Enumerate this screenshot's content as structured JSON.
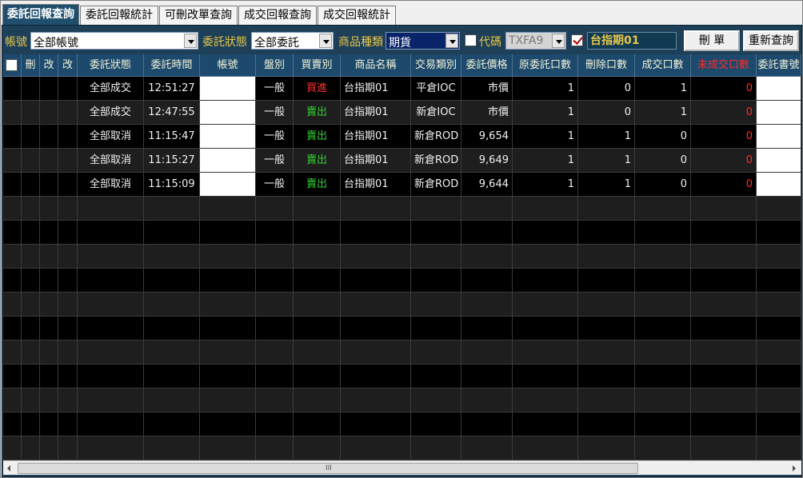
{
  "tabs": [
    {
      "label": "委託回報查詢",
      "active": true
    },
    {
      "label": "委託回報統計",
      "active": false
    },
    {
      "label": "可刪改單查詢",
      "active": false
    },
    {
      "label": "成交回報查詢",
      "active": false
    },
    {
      "label": "成交回報統計",
      "active": false
    }
  ],
  "toolbar": {
    "account_label": "帳號",
    "account_value": "全部帳號",
    "status_label": "委託狀態",
    "status_value": "全部委託",
    "product_type_label": "商品種類",
    "product_type_value": "期貨",
    "code_label": "代碼",
    "code_checked": false,
    "code_value": "TXFA9",
    "product_checked": true,
    "product_name": "台指期01",
    "delete_button": "刪 單",
    "requery_button": "重新查詢"
  },
  "table": {
    "headers": [
      "",
      "刪",
      "改",
      "改",
      "委託狀態",
      "委託時間",
      "帳號",
      "盤別",
      "買賣別",
      "商品名稱",
      "交易類別",
      "委託價格",
      "原委託口數",
      "刪除口數",
      "成交口數",
      "未成交口數",
      "委託書號"
    ],
    "rows": [
      {
        "status": "全部成交",
        "time": "12:51:27",
        "session": "一般",
        "side": "買進",
        "product": "台指期01",
        "trade_type": "平倉IOC",
        "price": "市價",
        "orig_qty": "1",
        "del_qty": "0",
        "filled_qty": "1",
        "unfilled_qty": "0"
      },
      {
        "status": "全部成交",
        "time": "12:47:55",
        "session": "一般",
        "side": "賣出",
        "product": "台指期01",
        "trade_type": "新倉IOC",
        "price": "市價",
        "orig_qty": "1",
        "del_qty": "0",
        "filled_qty": "1",
        "unfilled_qty": "0"
      },
      {
        "status": "全部取消",
        "time": "11:15:47",
        "session": "一般",
        "side": "賣出",
        "product": "台指期01",
        "trade_type": "新倉ROD",
        "price": "9,654",
        "orig_qty": "1",
        "del_qty": "1",
        "filled_qty": "0",
        "unfilled_qty": "0"
      },
      {
        "status": "全部取消",
        "time": "11:15:27",
        "session": "一般",
        "side": "賣出",
        "product": "台指期01",
        "trade_type": "新倉ROD",
        "price": "9,649",
        "orig_qty": "1",
        "del_qty": "1",
        "filled_qty": "0",
        "unfilled_qty": "0"
      },
      {
        "status": "全部取消",
        "time": "11:15:09",
        "session": "一般",
        "side": "賣出",
        "product": "台指期01",
        "trade_type": "新倉ROD",
        "price": "9,644",
        "orig_qty": "1",
        "del_qty": "1",
        "filled_qty": "0",
        "unfilled_qty": "0"
      }
    ]
  },
  "scrollbar": {
    "grip": "III"
  },
  "colors": {
    "panel": "#1d3f58",
    "header": "#1d4a6c",
    "label": "#e8c74a",
    "buy": "#ff3030",
    "sell": "#33cc33"
  }
}
